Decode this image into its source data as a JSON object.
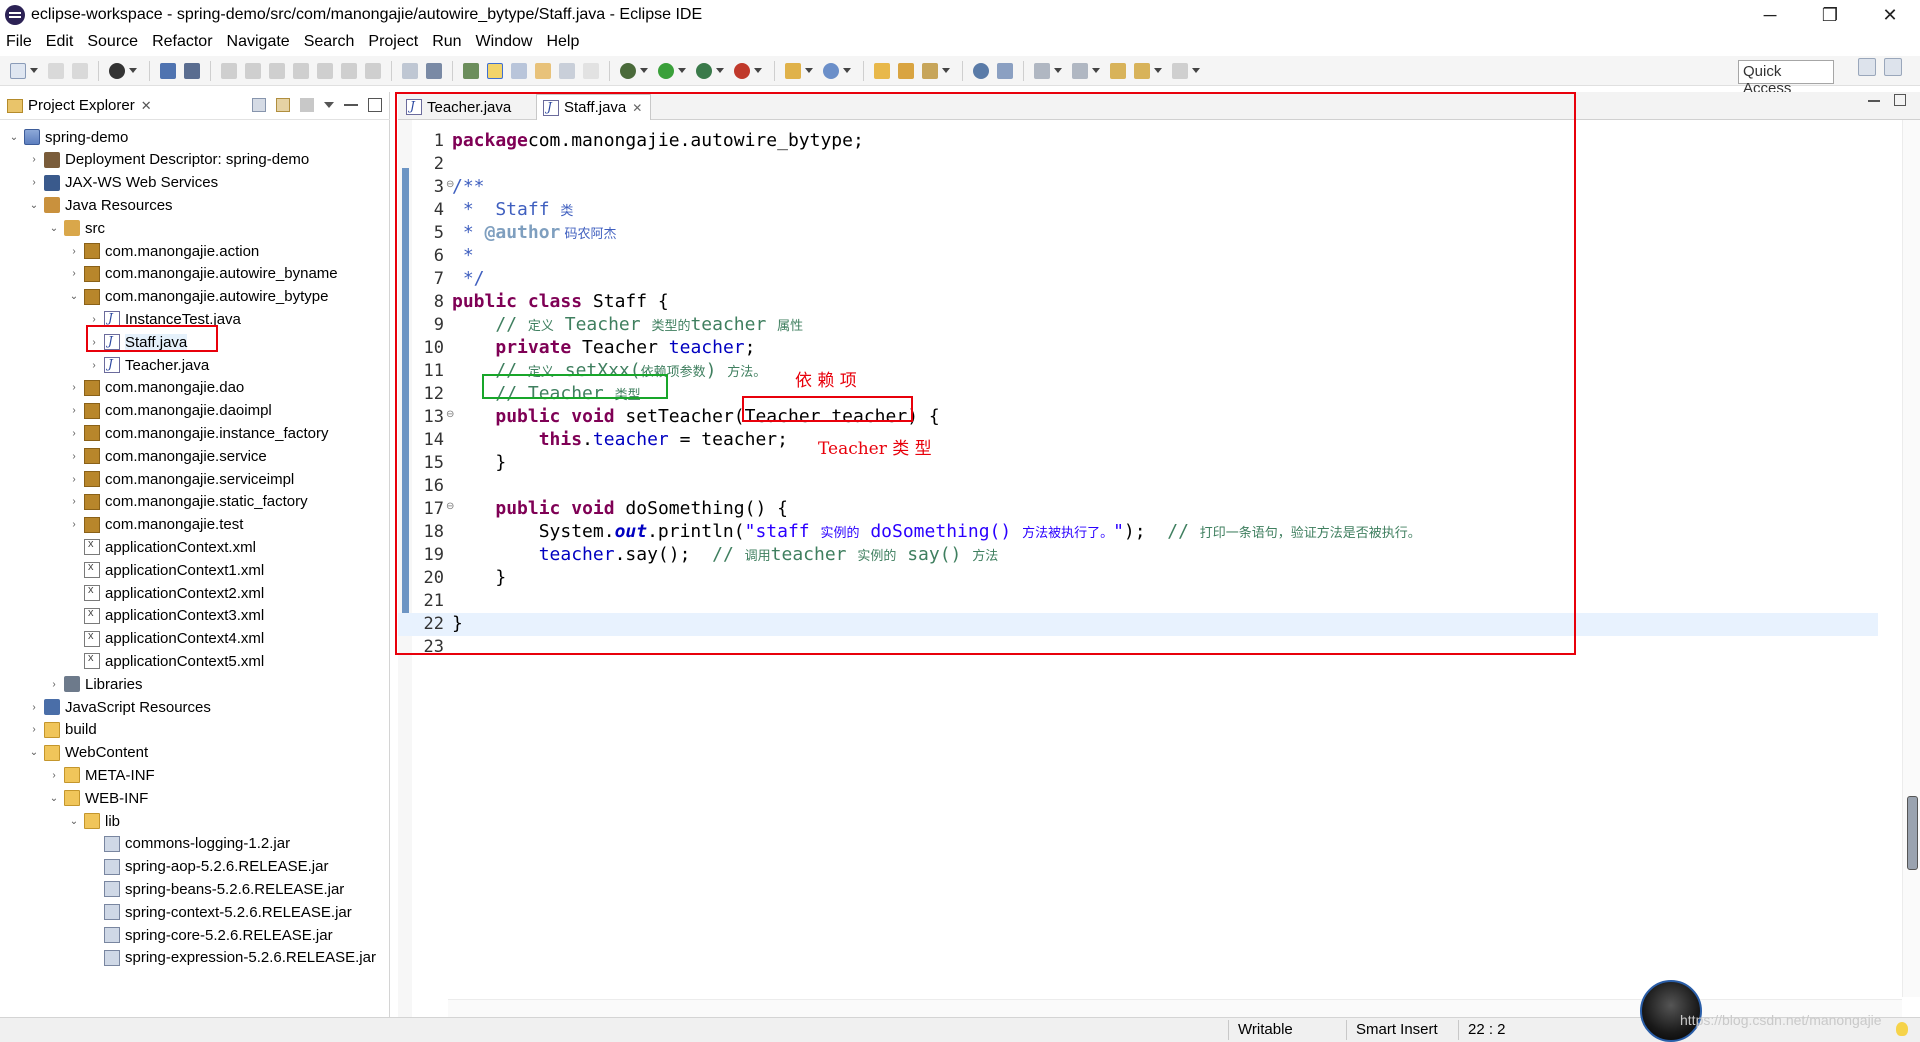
{
  "window": {
    "title": "eclipse-workspace - spring-demo/src/com/manongajie/autowire_bytype/Staff.java - Eclipse IDE",
    "min_glyph": "─",
    "max_glyph": "❐",
    "close_glyph": "✕"
  },
  "menu": [
    "File",
    "Edit",
    "Source",
    "Refactor",
    "Navigate",
    "Search",
    "Project",
    "Run",
    "Window",
    "Help"
  ],
  "toolbar": {
    "quick_access": "Quick Access"
  },
  "project_explorer": {
    "title": "Project Explorer",
    "close_glyph": "✕",
    "tree": [
      {
        "label": "spring-demo",
        "depth": 0,
        "twisty": "open",
        "icon": "project-icon"
      },
      {
        "label": "Deployment Descriptor: spring-demo",
        "depth": 1,
        "twisty": "closed",
        "icon": "descriptor-icon"
      },
      {
        "label": "JAX-WS Web Services",
        "depth": 1,
        "twisty": "closed",
        "icon": "ws-icon"
      },
      {
        "label": "Java Resources",
        "depth": 1,
        "twisty": "open",
        "icon": "javares-icon"
      },
      {
        "label": "src",
        "depth": 2,
        "twisty": "open",
        "icon": "srcfolder-icon"
      },
      {
        "label": "com.manongajie.action",
        "depth": 3,
        "twisty": "closed",
        "icon": "package-icon"
      },
      {
        "label": "com.manongajie.autowire_byname",
        "depth": 3,
        "twisty": "closed",
        "icon": "package-icon"
      },
      {
        "label": "com.manongajie.autowire_bytype",
        "depth": 3,
        "twisty": "open",
        "icon": "package-icon"
      },
      {
        "label": "InstanceTest.java",
        "depth": 4,
        "twisty": "closed",
        "icon": "java-file-icon"
      },
      {
        "label": "Staff.java",
        "depth": 4,
        "twisty": "closed",
        "icon": "java-file-icon",
        "selected": true
      },
      {
        "label": "Teacher.java",
        "depth": 4,
        "twisty": "closed",
        "icon": "java-file-icon"
      },
      {
        "label": "com.manongajie.dao",
        "depth": 3,
        "twisty": "closed",
        "icon": "package-icon"
      },
      {
        "label": "com.manongajie.daoimpl",
        "depth": 3,
        "twisty": "closed",
        "icon": "package-icon"
      },
      {
        "label": "com.manongajie.instance_factory",
        "depth": 3,
        "twisty": "closed",
        "icon": "package-icon"
      },
      {
        "label": "com.manongajie.service",
        "depth": 3,
        "twisty": "closed",
        "icon": "package-icon"
      },
      {
        "label": "com.manongajie.serviceimpl",
        "depth": 3,
        "twisty": "closed",
        "icon": "package-icon"
      },
      {
        "label": "com.manongajie.static_factory",
        "depth": 3,
        "twisty": "closed",
        "icon": "package-icon"
      },
      {
        "label": "com.manongajie.test",
        "depth": 3,
        "twisty": "closed",
        "icon": "package-icon"
      },
      {
        "label": "applicationContext.xml",
        "depth": 3,
        "twisty": "none",
        "icon": "xml-file-icon"
      },
      {
        "label": "applicationContext1.xml",
        "depth": 3,
        "twisty": "none",
        "icon": "xml-file-icon"
      },
      {
        "label": "applicationContext2.xml",
        "depth": 3,
        "twisty": "none",
        "icon": "xml-file-icon"
      },
      {
        "label": "applicationContext3.xml",
        "depth": 3,
        "twisty": "none",
        "icon": "xml-file-icon"
      },
      {
        "label": "applicationContext4.xml",
        "depth": 3,
        "twisty": "none",
        "icon": "xml-file-icon"
      },
      {
        "label": "applicationContext5.xml",
        "depth": 3,
        "twisty": "none",
        "icon": "xml-file-icon"
      },
      {
        "label": "Libraries",
        "depth": 2,
        "twisty": "closed",
        "icon": "library-icon"
      },
      {
        "label": "JavaScript Resources",
        "depth": 1,
        "twisty": "closed",
        "icon": "jsres-icon"
      },
      {
        "label": "build",
        "depth": 1,
        "twisty": "closed",
        "icon": "folder-icon"
      },
      {
        "label": "WebContent",
        "depth": 1,
        "twisty": "open",
        "icon": "folder-icon"
      },
      {
        "label": "META-INF",
        "depth": 2,
        "twisty": "closed",
        "icon": "folder-icon"
      },
      {
        "label": "WEB-INF",
        "depth": 2,
        "twisty": "open",
        "icon": "folder-icon"
      },
      {
        "label": "lib",
        "depth": 3,
        "twisty": "open",
        "icon": "folder-icon"
      },
      {
        "label": "commons-logging-1.2.jar",
        "depth": 4,
        "twisty": "none",
        "icon": "jar-icon"
      },
      {
        "label": "spring-aop-5.2.6.RELEASE.jar",
        "depth": 4,
        "twisty": "none",
        "icon": "jar-icon"
      },
      {
        "label": "spring-beans-5.2.6.RELEASE.jar",
        "depth": 4,
        "twisty": "none",
        "icon": "jar-icon"
      },
      {
        "label": "spring-context-5.2.6.RELEASE.jar",
        "depth": 4,
        "twisty": "none",
        "icon": "jar-icon"
      },
      {
        "label": "spring-core-5.2.6.RELEASE.jar",
        "depth": 4,
        "twisty": "none",
        "icon": "jar-icon"
      },
      {
        "label": "spring-expression-5.2.6.RELEASE.jar",
        "depth": 4,
        "twisty": "none",
        "icon": "jar-icon"
      }
    ]
  },
  "editor": {
    "tabs": [
      {
        "label": "Teacher.java",
        "active": false
      },
      {
        "label": "Staff.java",
        "active": true
      }
    ],
    "current_line": 22,
    "lines": [
      {
        "n": "1",
        "fold": "",
        "tokens": [
          [
            "kw",
            "package"
          ],
          [
            "",
            "com.manongajie.autowire_bytype;"
          ]
        ]
      },
      {
        "n": "2",
        "fold": "",
        "tokens": []
      },
      {
        "n": "3",
        "fold": "⊖",
        "tokens": [
          [
            "cm",
            "/**"
          ]
        ]
      },
      {
        "n": "4",
        "fold": "",
        "tokens": [
          [
            "cm",
            " *  Staff "
          ],
          [
            "cm cn",
            "类"
          ]
        ]
      },
      {
        "n": "5",
        "fold": "",
        "tokens": [
          [
            "cm",
            " * "
          ],
          [
            "tag",
            "@author"
          ],
          [
            "cm cn",
            " 码农阿杰"
          ]
        ]
      },
      {
        "n": "6",
        "fold": "",
        "tokens": [
          [
            "cm",
            " *"
          ]
        ]
      },
      {
        "n": "7",
        "fold": "",
        "tokens": [
          [
            "cm",
            " */"
          ]
        ]
      },
      {
        "n": "8",
        "fold": "",
        "tokens": [
          [
            "kw",
            "public"
          ],
          [
            "",
            " "
          ],
          [
            "kw",
            "class"
          ],
          [
            "",
            " Staff {"
          ]
        ]
      },
      {
        "n": "9",
        "fold": "",
        "tokens": [
          [
            "",
            "    "
          ],
          [
            "lc",
            "// "
          ],
          [
            "lc cn",
            "定义"
          ],
          [
            "lc",
            " Teacher "
          ],
          [
            "lc cn",
            "类型的"
          ],
          [
            "lc",
            "teacher "
          ],
          [
            "lc cn",
            "属性"
          ]
        ]
      },
      {
        "n": "10",
        "fold": "",
        "tokens": [
          [
            "",
            "    "
          ],
          [
            "kw",
            "private"
          ],
          [
            "",
            " Teacher "
          ],
          [
            "fld",
            "teacher"
          ],
          [
            "",
            ";"
          ]
        ]
      },
      {
        "n": "11",
        "fold": "",
        "tokens": [
          [
            "",
            "    "
          ],
          [
            "lc",
            "// "
          ],
          [
            "lc cn",
            "定义"
          ],
          [
            "lc",
            " setXxx("
          ],
          [
            "lc cn",
            "依赖项参数"
          ],
          [
            "lc",
            ") "
          ],
          [
            "lc cn",
            "方法。"
          ]
        ]
      },
      {
        "n": "12",
        "fold": "",
        "tokens": [
          [
            "",
            "    "
          ],
          [
            "lc",
            "// Teacher "
          ],
          [
            "lc cn",
            "类型"
          ]
        ]
      },
      {
        "n": "13",
        "fold": "⊖",
        "tokens": [
          [
            "",
            "    "
          ],
          [
            "kw",
            "public"
          ],
          [
            "",
            " "
          ],
          [
            "kw",
            "void"
          ],
          [
            "",
            " setTeacher(Teacher teacher) {"
          ]
        ]
      },
      {
        "n": "14",
        "fold": "",
        "tokens": [
          [
            "",
            "        "
          ],
          [
            "kw",
            "this"
          ],
          [
            "",
            "."
          ],
          [
            "fld",
            "teacher"
          ],
          [
            "",
            " = teacher;"
          ]
        ]
      },
      {
        "n": "15",
        "fold": "",
        "tokens": [
          [
            "",
            "    }"
          ]
        ]
      },
      {
        "n": "16",
        "fold": "",
        "tokens": []
      },
      {
        "n": "17",
        "fold": "⊖",
        "tokens": [
          [
            "",
            "    "
          ],
          [
            "kw",
            "public"
          ],
          [
            "",
            " "
          ],
          [
            "kw",
            "void"
          ],
          [
            "",
            " doSomething() {"
          ]
        ]
      },
      {
        "n": "18",
        "fold": "",
        "tokens": [
          [
            "",
            "        System."
          ],
          [
            "sfld",
            "out"
          ],
          [
            "",
            ".println("
          ],
          [
            "st",
            "\"staff "
          ],
          [
            "st cn",
            "实例的"
          ],
          [
            "st",
            " doSomething() "
          ],
          [
            "st cn",
            "方法被执行了。"
          ],
          [
            "st",
            "\""
          ],
          [
            "",
            ");  "
          ],
          [
            "lc",
            "// "
          ],
          [
            "lc cn",
            "打印一条语句，验证方法是否被执行。"
          ]
        ]
      },
      {
        "n": "19",
        "fold": "",
        "tokens": [
          [
            "",
            "        "
          ],
          [
            "fld",
            "teacher"
          ],
          [
            "",
            ".say();  "
          ],
          [
            "lc",
            "// "
          ],
          [
            "lc cn",
            "调用"
          ],
          [
            "lc",
            "teacher "
          ],
          [
            "lc cn",
            "实例的"
          ],
          [
            "lc",
            " say() "
          ],
          [
            "lc cn",
            "方法"
          ]
        ]
      },
      {
        "n": "20",
        "fold": "",
        "tokens": [
          [
            "",
            "    }"
          ]
        ]
      },
      {
        "n": "21",
        "fold": "",
        "tokens": []
      },
      {
        "n": "22",
        "fold": "",
        "tokens": [
          [
            "",
            "}"
          ]
        ]
      },
      {
        "n": "23",
        "fold": "",
        "tokens": []
      }
    ]
  },
  "annotations": {
    "dependency_label": "依 赖 项",
    "type_label": "Teacher 类 型"
  },
  "status": {
    "writable": "Writable",
    "insert_mode": "Smart Insert",
    "position": "22 : 2"
  },
  "watermark": "https://blog.csdn.net/manongajie"
}
